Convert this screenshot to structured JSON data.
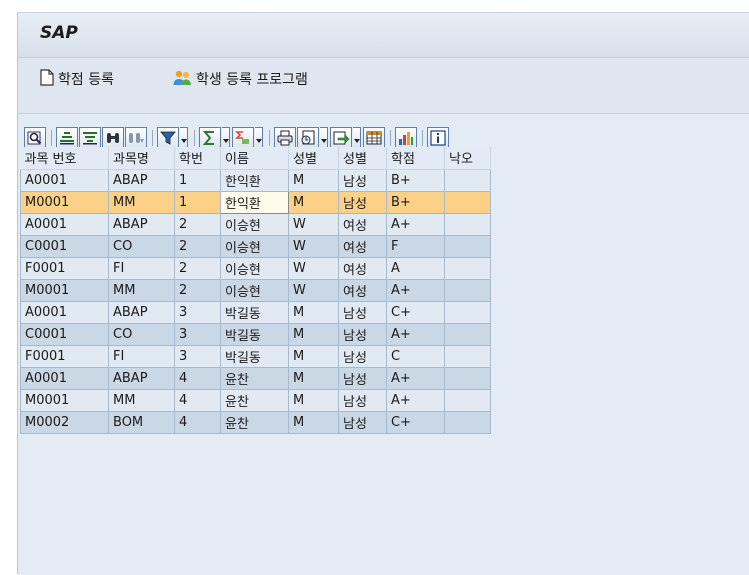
{
  "app": {
    "title": "SAP"
  },
  "app_toolbar": {
    "items": [
      {
        "label": "학점 등록",
        "icon": "document-icon"
      },
      {
        "label": "학생 등록 프로그램",
        "icon": "people-icon"
      }
    ]
  },
  "alv_toolbar": {
    "buttons": [
      "details-icon",
      "sort-ascending-icon",
      "sort-descending-icon",
      "find-icon",
      "find-next-icon",
      "filter-icon",
      "total-icon",
      "subtotal-icon",
      "print-icon",
      "views-icon",
      "export-icon",
      "layout-icon",
      "graphic-icon",
      "info-icon"
    ]
  },
  "grid": {
    "columns": [
      "과목 번호",
      "과목명",
      "학번",
      "이름",
      "성별",
      "성별",
      "학점",
      "낙오"
    ],
    "rows": [
      [
        "A0001",
        "ABAP",
        "1",
        "한익환",
        "M",
        "남성",
        "B+",
        ""
      ],
      [
        "M0001",
        "MM",
        "1",
        "한익환",
        "M",
        "남성",
        "B+",
        ""
      ],
      [
        "A0001",
        "ABAP",
        "2",
        "이승현",
        "W",
        "여성",
        "A+",
        ""
      ],
      [
        "C0001",
        "CO",
        "2",
        "이승현",
        "W",
        "여성",
        "F",
        ""
      ],
      [
        "F0001",
        "FI",
        "2",
        "이승현",
        "W",
        "여성",
        "A",
        ""
      ],
      [
        "M0001",
        "MM",
        "2",
        "이승현",
        "W",
        "여성",
        "A+",
        ""
      ],
      [
        "A0001",
        "ABAP",
        "3",
        "박길동",
        "M",
        "남성",
        "C+",
        ""
      ],
      [
        "C0001",
        "CO",
        "3",
        "박길동",
        "M",
        "남성",
        "A+",
        ""
      ],
      [
        "F0001",
        "FI",
        "3",
        "박길동",
        "M",
        "남성",
        "C",
        ""
      ],
      [
        "A0001",
        "ABAP",
        "4",
        "윤찬",
        "M",
        "남성",
        "A+",
        ""
      ],
      [
        "M0001",
        "MM",
        "4",
        "윤찬",
        "M",
        "남성",
        "A+",
        ""
      ],
      [
        "M0002",
        "BOM",
        "4",
        "윤찬",
        "M",
        "남성",
        "C+",
        ""
      ]
    ],
    "selected_row": 1,
    "current_cell_column": 3
  },
  "colors": {
    "selected_row": "#fbd187",
    "row_light": "#e1e9f3",
    "row_dark": "#cad7e5",
    "toolbar_border": "#5f7fa8"
  }
}
